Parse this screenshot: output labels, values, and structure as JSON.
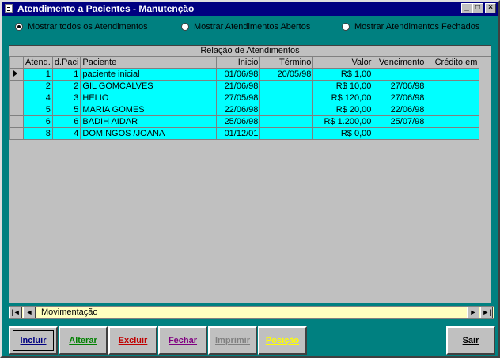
{
  "window": {
    "title": "Atendimento a Pacientes - Manutenção"
  },
  "titlebar_buttons": {
    "minimize": "_",
    "maximize": "□",
    "close": "×"
  },
  "filters": [
    {
      "label": "Mostrar todos os Atendimentos",
      "selected": true
    },
    {
      "label": "Mostrar Atendimentos Abertos",
      "selected": false
    },
    {
      "label": "Mostrar Atendimentos Fechados",
      "selected": false
    }
  ],
  "grid": {
    "caption": "Relação de Atendimentos",
    "columns": [
      "Atend.",
      "d.Paci",
      "Paciente",
      "Inicio",
      "Término",
      "Valor",
      "Vencimento",
      "Crédito em"
    ],
    "rows": [
      [
        "1",
        "1",
        "paciente inicial",
        "01/06/98",
        "20/05/98",
        "R$ 1,00",
        "",
        ""
      ],
      [
        "2",
        "2",
        "GIL GOMCALVES",
        "21/06/98",
        "",
        "R$ 10,00",
        "27/06/98",
        ""
      ],
      [
        "4",
        "3",
        "HELIO",
        "27/05/98",
        "",
        "R$ 120,00",
        "27/06/98",
        ""
      ],
      [
        "5",
        "5",
        "MARIA GOMES",
        "22/06/98",
        "",
        "R$ 20,00",
        "22/06/98",
        ""
      ],
      [
        "6",
        "6",
        "BADIH AIDAR",
        "25/06/98",
        "",
        "R$ 1.200,00",
        "25/07/98",
        ""
      ],
      [
        "8",
        "4",
        "DOMINGOS /JOANA",
        "01/12/01",
        "",
        "R$ 0,00",
        "",
        ""
      ]
    ],
    "current_row": 0
  },
  "navigator": {
    "caption": "Movimentação",
    "first": "|◄",
    "prev": "◄",
    "next": "►",
    "last": "►|"
  },
  "buttons": {
    "incluir": {
      "label": "Incluir",
      "color": "#000080"
    },
    "alterar": {
      "label": "Alterar",
      "color": "#008000"
    },
    "excluir": {
      "label": "Excluir",
      "color": "#c00000"
    },
    "fechar": {
      "label": "Fechar",
      "color": "#800080"
    },
    "imprimir": {
      "label": "Imprimir",
      "color": "#808080"
    },
    "posicao": {
      "label": "Posição",
      "color": "#ffff00"
    },
    "sair": {
      "label": "Sair",
      "color": "#000000"
    }
  }
}
